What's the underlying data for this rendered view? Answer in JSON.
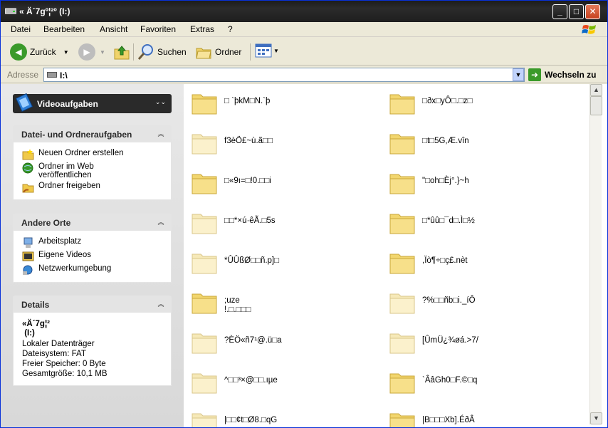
{
  "window": {
    "title": "« Ä´7gº¦²º  (I:)",
    "minimize_label": "_",
    "maximize_label": "□",
    "close_label": "✕"
  },
  "menu": [
    "Datei",
    "Bearbeiten",
    "Ansicht",
    "Favoriten",
    "Extras",
    "?"
  ],
  "toolbar": {
    "back_label": "Zurück",
    "search_label": "Suchen",
    "folders_label": "Ordner"
  },
  "address": {
    "label": "Adresse",
    "value": "I:\\",
    "go_label": "Wechseln zu"
  },
  "taskpane": {
    "video_title": "Videoaufgaben",
    "file_tasks_title": "Datei- und Ordneraufgaben",
    "file_tasks": [
      "Neuen Ordner erstellen",
      "Ordner im Web\nveröffentlichen",
      "Ordner freigeben"
    ],
    "other_places_title": "Andere Orte",
    "other_places": [
      "Arbeitsplatz",
      "Eigene Videos",
      "Netzwerkumgebung"
    ],
    "details_title": "Details",
    "details": {
      "name": "«Ä´7g¦²\n (I:)",
      "type": "Lokaler Datenträger",
      "filesystem": "Dateisystem: FAT",
      "free": "Freier Speicher: 0 Byte",
      "total": "Gesamtgröße: 10,1 MB"
    }
  },
  "files": [
    "□ `þkM□N.`þ",
    "□ðx□yÔ□.□z□",
    "f3èÖ£~ù.ã□□",
    "□t□5G,Æ.vîn",
    "□«9ı=□!0.□□i",
    "\"□oh□Èj°.}~h",
    "□□*×ú·êÃ.□5s",
    "□*ûû□¯d□.Ì□½",
    "*ÛÛßØ□□ñ.p]□",
    ",Ïò¶÷□ç£.nèt",
    ";uze\n!.□.□□□",
    "?%□□ñb□i._íÔ",
    "?ÈÖ«ñ7¹@.ü□a",
    "[ÛmÜ¿¾øá.>7/",
    "^□□³×@□□.ıµe",
    "`ÂâGh0□F.©□q",
    "|□□¢t□Ø8.□qG",
    "|B□□□Xb].ÉðÂ"
  ]
}
